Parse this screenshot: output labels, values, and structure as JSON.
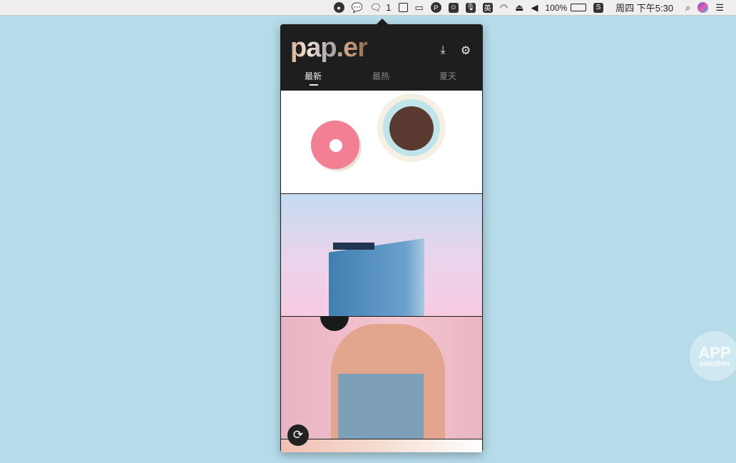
{
  "menubar": {
    "wechat_count": "1",
    "input_method": "英",
    "battery": "100%",
    "clock": "周四 下午5:30",
    "p_icon": "P"
  },
  "popup": {
    "logo": "pap.er",
    "tabs": [
      {
        "label": "最新",
        "active": true
      },
      {
        "label": "最热",
        "active": false
      },
      {
        "label": "夏天",
        "active": false
      }
    ]
  },
  "watermark": {
    "line1": "APP",
    "line2": "solution"
  }
}
